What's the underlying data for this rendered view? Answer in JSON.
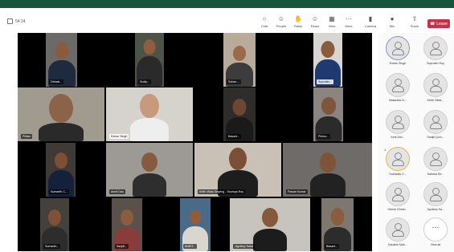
{
  "meeting": {
    "timer": "54:24"
  },
  "toolbar": {
    "items": [
      {
        "label": "Chat",
        "icon": "chat-icon"
      },
      {
        "label": "People",
        "icon": "people-icon"
      },
      {
        "label": "Raise",
        "icon": "raise-hand-icon"
      },
      {
        "label": "React",
        "icon": "react-icon"
      },
      {
        "label": "View",
        "icon": "view-icon"
      },
      {
        "label": "More",
        "icon": "more-icon"
      },
      {
        "label": "Camera",
        "icon": "camera-icon"
      },
      {
        "label": "Mic",
        "icon": "mic-icon"
      },
      {
        "label": "Share",
        "icon": "share-icon"
      }
    ],
    "leave_label": "Leave",
    "leave_color": "#c4314b"
  },
  "tiles": [
    {
      "name": "Debasi..."
    },
    {
      "name": "Sudip..."
    },
    {
      "name": "Sohan ..."
    },
    {
      "name": "Supratim..."
    },
    {
      "name": "Pritam"
    },
    {
      "name": "Eshan Singh"
    },
    {
      "name": "Basant..."
    },
    {
      "name": "Pintoo..."
    },
    {
      "name": "Sumanth C..."
    },
    {
      "name": "Amrit Das"
    },
    {
      "name": "Kritik Vikas Ghyeng - Soumya Roy"
    },
    {
      "name": "Pawan Kumar"
    },
    {
      "name": "Sumanth..."
    },
    {
      "name": "Sanjib..."
    },
    {
      "name": "ANKIT..."
    },
    {
      "name": "Jaydeep Saha"
    },
    {
      "name": "Basant..."
    }
  ],
  "participants": [
    {
      "name": "Eshan Singh"
    },
    {
      "name": "Supratim Roy"
    },
    {
      "name": "Basantas N..."
    },
    {
      "name": "Kritik Vikas..."
    },
    {
      "name": "Amit Dev..."
    },
    {
      "name": "Sanjib (Unv..."
    },
    {
      "name": "Subhasis C..."
    },
    {
      "name": "Sahana Se..."
    },
    {
      "name": "Hiresh Ghosh..."
    },
    {
      "name": "Jaydeep Sa..."
    },
    {
      "name": "Kaushik Mah..."
    }
  ],
  "view_all_label": "View all",
  "raised_count": "1"
}
